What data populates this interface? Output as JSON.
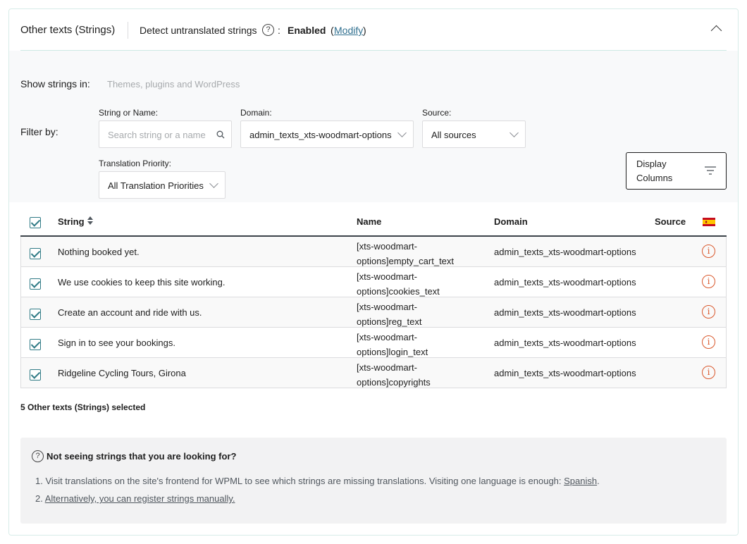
{
  "header": {
    "title": "Other texts (Strings)",
    "detect_label": "Detect untranslated strings",
    "help_glyph": "?",
    "colon": ":",
    "status": "Enabled",
    "paren_open": "(",
    "modify_label": "Modify",
    "paren_close": ")"
  },
  "filters": {
    "show_strings_label": "Show strings in:",
    "show_strings_placeholder": "Themes, plugins and WordPress",
    "filter_by_label": "Filter by:",
    "string_or_name_label": "String or Name:",
    "search_placeholder": "Search string or a name",
    "domain_label": "Domain:",
    "domain_value": "admin_texts_xts-woodmart-options",
    "source_label": "Source:",
    "source_value": "All sources",
    "priority_label": "Translation Priority:",
    "priority_value": "All Translation Priorities",
    "display_columns_line1": "Display",
    "display_columns_line2": "Columns"
  },
  "table": {
    "headers": {
      "string": "String",
      "name": "Name",
      "domain": "Domain",
      "source": "Source"
    },
    "rows": [
      {
        "string": "Nothing booked yet.",
        "name_line1": "[xts-woodmart-",
        "name_line2": "options]empty_cart_text",
        "domain": "admin_texts_xts-woodmart-options"
      },
      {
        "string": "We use cookies to keep this site working.",
        "name_line1": "[xts-woodmart-",
        "name_line2": "options]cookies_text",
        "domain": "admin_texts_xts-woodmart-options"
      },
      {
        "string": "Create an account and ride with us.",
        "name_line1": "[xts-woodmart-",
        "name_line2": "options]reg_text",
        "domain": "admin_texts_xts-woodmart-options"
      },
      {
        "string": "Sign in to see your bookings.",
        "name_line1": "[xts-woodmart-",
        "name_line2": "options]login_text",
        "domain": "admin_texts_xts-woodmart-options"
      },
      {
        "string": "Ridgeline Cycling Tours, Girona",
        "name_line1": "[xts-woodmart-",
        "name_line2": "options]copyrights",
        "domain": "admin_texts_xts-woodmart-options"
      }
    ]
  },
  "selected_count": "5 Other texts (Strings) selected",
  "help": {
    "title": "Not seeing strings that you are looking for?",
    "item1_text": "1. Visit translations on the site's frontend for WPML to see which strings are missing translations. Visiting one language is enough: ",
    "item1_link": "Spanish",
    "item1_end": ".",
    "item2_prefix": "2. ",
    "item2_link": "Alternatively, you can register strings manually."
  },
  "colors": {
    "accent": "#2f7a85",
    "link": "#2f6f8f",
    "warning": "#d9572b",
    "header_divider": "#cde8e3"
  },
  "icons": {
    "help": "question-circle-icon",
    "collapse": "chevron-up-icon",
    "search": "magnifier-icon",
    "filter": "filter-lines-icon",
    "sort": "sort-arrows-icon",
    "language": "spanish-flag-icon",
    "row_status": "info-circle-icon"
  }
}
